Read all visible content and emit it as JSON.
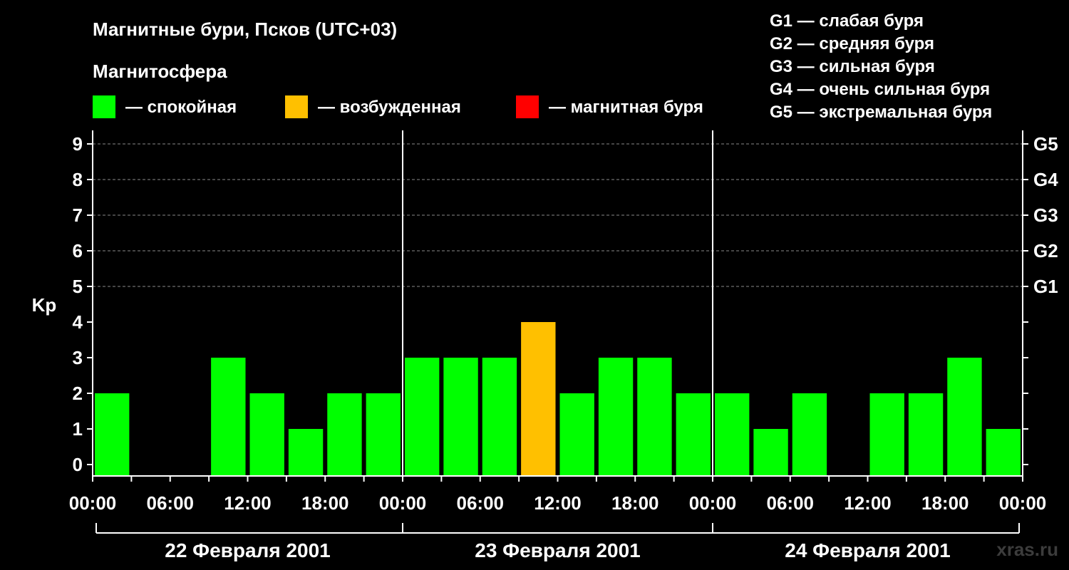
{
  "chart_data": {
    "type": "bar",
    "title": "Магнитные бури, Псков (UTC+03)",
    "ylabel": "Kp",
    "ylim": [
      0,
      9
    ],
    "yticks": [
      "0",
      "1",
      "2",
      "3",
      "4",
      "5",
      "6",
      "7",
      "8",
      "9"
    ],
    "storm_levels": [
      {
        "label": "G1",
        "kp": 5
      },
      {
        "label": "G2",
        "kp": 6
      },
      {
        "label": "G3",
        "kp": 7
      },
      {
        "label": "G4",
        "kp": 8
      },
      {
        "label": "G5",
        "kp": 9
      }
    ],
    "grid": "dashed horizontal lines at Kp 5–9",
    "xticks": [
      "00:00",
      "06:00",
      "12:00",
      "18:00",
      "00:00",
      "06:00",
      "12:00",
      "18:00",
      "00:00",
      "06:00",
      "12:00",
      "18:00",
      "00:00"
    ],
    "days": [
      "22 Февраля 2001",
      "23 Февраля 2001",
      "24 Февраля 2001"
    ],
    "interval_hours": 3,
    "values": [
      2,
      0,
      0,
      3,
      2,
      1,
      2,
      2,
      3,
      3,
      3,
      4,
      2,
      3,
      3,
      2,
      2,
      1,
      2,
      0,
      2,
      2,
      3,
      1
    ],
    "colors": {
      "quiet": "#00ff00",
      "active": "#ffc000",
      "storm": "#ff0000"
    },
    "color_rule": {
      "quiet_max": 3,
      "active_max": 4
    }
  },
  "legend": {
    "magnetosphere_title": "Магнитосфера",
    "items": [
      {
        "color": "#00ff00",
        "label": "— спокойная"
      },
      {
        "color": "#ffc000",
        "label": "— возбужденная"
      },
      {
        "color": "#ff0000",
        "label": "— магнитная буря"
      }
    ],
    "storm_scale": [
      "G1 — слабая буря",
      "G2 — средняя буря",
      "G3 — сильная буря",
      "G4 — очень сильная буря",
      "G5 — экстремальная буря"
    ]
  },
  "watermark": "xras.ru"
}
